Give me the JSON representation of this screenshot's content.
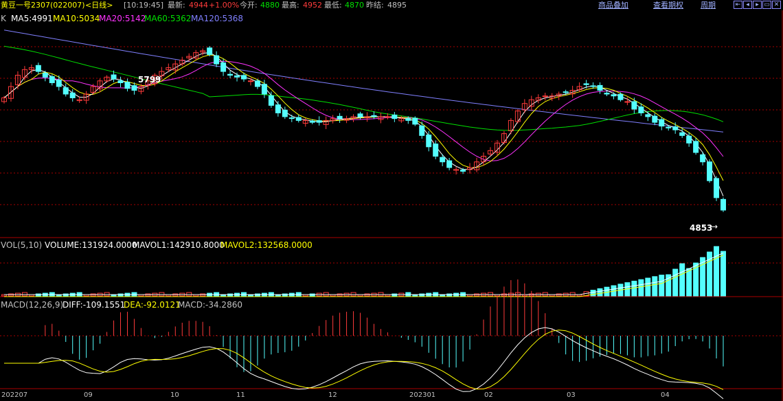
{
  "header": {
    "symbol": "黄豆一号2307",
    "code": "(022007)",
    "period": "<日线>",
    "time": "[10:19:45]",
    "latest_label": "最新:",
    "latest_value": "4944",
    "change": "+1.00%",
    "open_label": "今开:",
    "open_value": "4880",
    "high_label": "最高:",
    "high_value": "4952",
    "low_label": "最低:",
    "low_value": "4870",
    "prev_label": "昨结:",
    "prev_value": "4895",
    "link_overlay": "商品叠加",
    "link_rights": "查看期权",
    "link_period": "周期"
  },
  "price_panel": {
    "k_label": "K",
    "ma5": "MA5:4991",
    "ma10": "MA10:5034",
    "ma20": "MA20:5142",
    "ma60": "MA60:5362",
    "ma120": "MA120:5368",
    "high_mark": "5799",
    "low_mark": "4853"
  },
  "volume_panel": {
    "vol": "VOL(5,10)",
    "volume": "VOLUME:131924.0000",
    "mavol1": "MAVOL1:142910.8000",
    "mavol2": "MAVOL2:132568.0000"
  },
  "macd_panel": {
    "macd": "MACD(12,26,9)",
    "diff": "DIFF:-109.1551",
    "dea": "DEA:-92.0121",
    "macd_value": "MACD:-34.2860"
  },
  "x_axis": [
    "202207",
    "09",
    "10",
    "11",
    "12",
    "202301",
    "02",
    "03",
    "04"
  ],
  "colors": {
    "up": "#ff3b3b",
    "down": "#54ffff",
    "ma5": "#ffffff",
    "ma10": "#ffff00",
    "ma20": "#ff33ff",
    "ma60": "#00e000",
    "ma120": "#8080ff",
    "grid": "#aa0000"
  },
  "chart_data": {
    "type": "candlestick",
    "close_series": [
      5540,
      5600,
      5660,
      5690,
      5700,
      5680,
      5650,
      5620,
      5600,
      5560,
      5540,
      5530,
      5560,
      5600,
      5630,
      5650,
      5640,
      5620,
      5590,
      5580,
      5600,
      5630,
      5660,
      5680,
      5700,
      5720,
      5740,
      5760,
      5780,
      5790,
      5770,
      5720,
      5680,
      5660,
      5650,
      5640,
      5630,
      5600,
      5560,
      5500,
      5460,
      5440,
      5430,
      5420,
      5420,
      5410,
      5410,
      5420,
      5430,
      5430,
      5430,
      5440,
      5440,
      5440,
      5440,
      5440,
      5440,
      5430,
      5430,
      5420,
      5400,
      5340,
      5280,
      5230,
      5200,
      5170,
      5160,
      5150,
      5170,
      5200,
      5230,
      5260,
      5300,
      5350,
      5420,
      5470,
      5510,
      5530,
      5540,
      5550,
      5550,
      5560,
      5570,
      5580,
      5600,
      5610,
      5600,
      5580,
      5560,
      5550,
      5530,
      5520,
      5480,
      5460,
      5440,
      5410,
      5390,
      5380,
      5370,
      5340,
      5300,
      5250,
      5200,
      5100,
      5010,
      4944
    ],
    "high": 5799,
    "low": 4853,
    "volume_trend": "low and flat through most of the period, rising sharply in the final weeks",
    "x_ticks": [
      "202207",
      "09",
      "10",
      "11",
      "12",
      "202301",
      "02",
      "03",
      "04"
    ]
  }
}
